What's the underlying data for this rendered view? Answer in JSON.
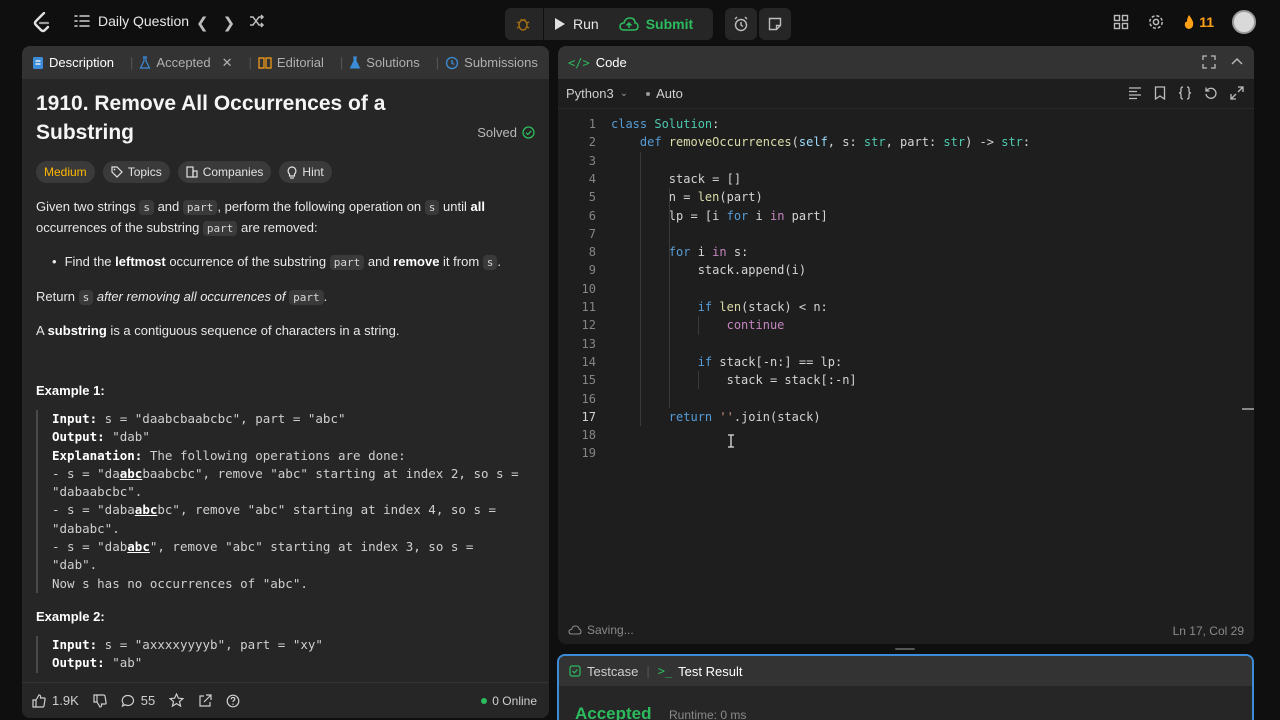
{
  "topbar": {
    "list_label": "Daily Question",
    "run_label": "Run",
    "submit_label": "Submit",
    "streak_count": "11"
  },
  "left_tabs": [
    {
      "label": "Description"
    },
    {
      "label": "Accepted"
    },
    {
      "label": "Editorial"
    },
    {
      "label": "Solutions"
    },
    {
      "label": "Submissions"
    }
  ],
  "problem": {
    "title": "1910. Remove All Occurrences of a Substring",
    "status": "Solved",
    "difficulty": "Medium",
    "topics_label": "Topics",
    "companies_label": "Companies",
    "hint_label": "Hint",
    "p1_a": "Given two strings ",
    "p1_s": "s",
    "p1_b": " and ",
    "p1_part": "part",
    "p1_c": ", perform the following operation on ",
    "p1_s2": "s",
    "p1_d": " until ",
    "p1_all": "all",
    "p1_e": " occurrences of the substring ",
    "p1_part2": "part",
    "p1_f": " are removed:",
    "bullet_a": "Find the ",
    "bullet_leftmost": "leftmost",
    "bullet_b": " occurrence of the substring ",
    "bullet_part": "part",
    "bullet_c": " and ",
    "bullet_remove": "remove",
    "bullet_d": " it from ",
    "bullet_s": "s",
    "bullet_e": ".",
    "p2_a": "Return ",
    "p2_s": "s",
    "p2_b": " after removing all occurrences of ",
    "p2_part": "part",
    "p2_c": ".",
    "p3_a": "A ",
    "p3_substring": "substring",
    "p3_b": " is a contiguous sequence of characters in a string.",
    "example1_title": "Example 1:",
    "example2_title": "Example 2:",
    "ex1_input_k": "Input:",
    "ex1_input_v": " s = \"daabcbaabcbc\", part = \"abc\"",
    "ex1_output_k": "Output:",
    "ex1_output_v": " \"dab\"",
    "ex1_expl_k": "Explanation:",
    "ex1_expl_v": " The following operations are done:",
    "ex1_l1_a": "- s = \"da",
    "ex1_l1_u": "abc",
    "ex1_l1_b": "baabcbc\", remove \"abc\" starting at index 2, so s =",
    "ex1_l1_c": "\"dabaabcbc\".",
    "ex1_l2_a": "- s = \"daba",
    "ex1_l2_u": "abc",
    "ex1_l2_b": "bc\", remove \"abc\" starting at index 4, so s =",
    "ex1_l2_c": "\"dababc\".",
    "ex1_l3_a": "- s = \"dab",
    "ex1_l3_u": "abc",
    "ex1_l3_b": "\", remove \"abc\" starting at index 3, so s =",
    "ex1_l3_c": "\"dab\".",
    "ex1_l4": "Now s has no occurrences of \"abc\".",
    "ex2_input_k": "Input:",
    "ex2_input_v": " s = \"axxxxyyyyb\", part = \"xy\"",
    "ex2_output_k": "Output:",
    "ex2_output_v": " \"ab\""
  },
  "bottom_bar": {
    "likes": "1.9K",
    "comments": "55",
    "online": "0 Online"
  },
  "code_panel": {
    "title": "Code",
    "language": "Python3",
    "mode": "Auto",
    "saving": "Saving...",
    "cursor_pos": "Ln 17, Col 29"
  },
  "code_lines": [
    "class Solution:",
    "    def removeOccurrences(self, s: str, part: str) -> str:",
    "",
    "        stack = []",
    "        n = len(part)",
    "        lp = [i for i in part]",
    "",
    "        for i in s:",
    "            stack.append(i)",
    "",
    "            if len(stack) < n:",
    "                continue",
    "",
    "            if stack[-n:] == lp:",
    "                stack = stack[:-n]",
    "",
    "        return ''.join(stack)",
    "",
    ""
  ],
  "test_panel": {
    "testcase_label": "Testcase",
    "result_label": "Test Result",
    "verdict": "Accepted",
    "runtime": "Runtime: 0 ms"
  },
  "colors": {
    "accent_green": "#2cbb5d",
    "medium_yellow": "#ffb800",
    "streak_orange": "#ffa116",
    "focus_blue": "#3c8dd9"
  }
}
